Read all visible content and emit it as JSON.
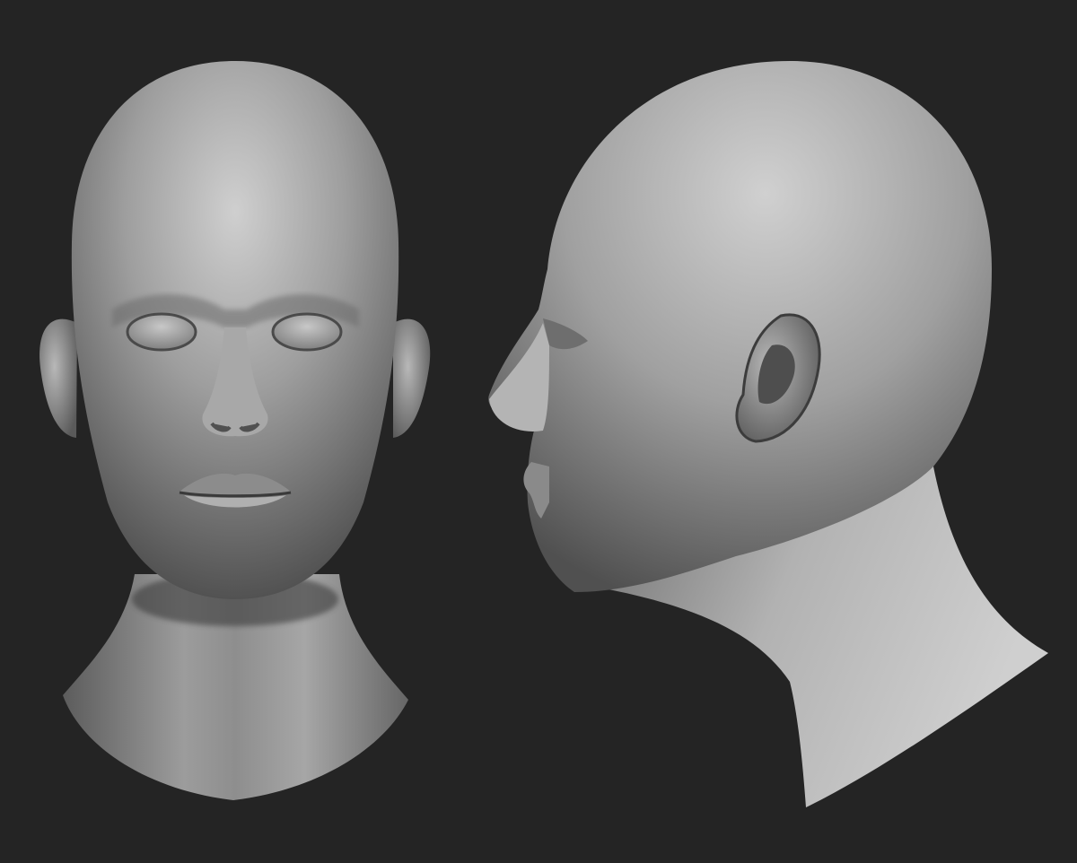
{
  "scene": {
    "background": "#242424",
    "clay_light": "#d2d2d2",
    "clay_mid": "#9a9a9a",
    "clay_dark": "#4a4a4a",
    "clay_shadow": "#1e1e1e"
  },
  "views": [
    {
      "subject": "front-view-head"
    },
    {
      "subject": "side-view-head"
    }
  ]
}
